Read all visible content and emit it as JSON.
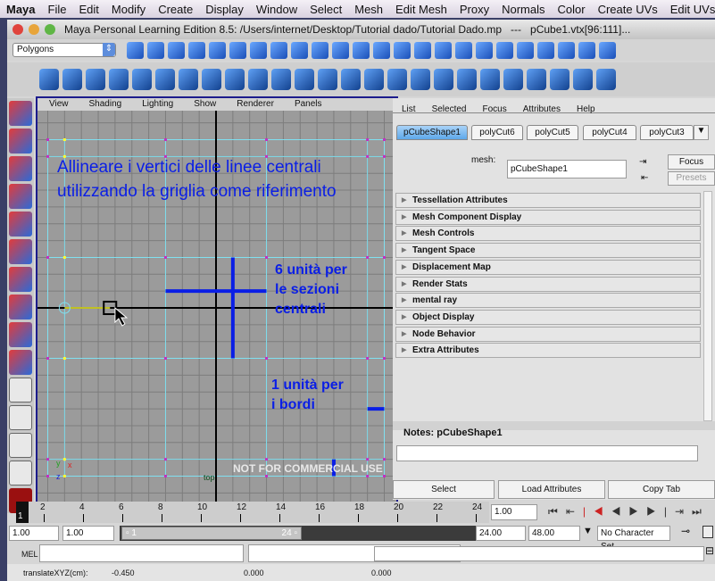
{
  "menubar": [
    "Maya",
    "File",
    "Edit",
    "Modify",
    "Create",
    "Display",
    "Window",
    "Select",
    "Mesh",
    "Edit Mesh",
    "Proxy",
    "Normals",
    "Color",
    "Create UVs",
    "Edit UVs"
  ],
  "window": {
    "title": "Maya Personal Learning Edition 8.5: /Users/internet/Desktop/Tutorial dado/Tutorial Dado.mp   ---   pCube1.vtx[96:111]..."
  },
  "mode_selector": "Polygons",
  "status_icons": [
    "new-scene-icon",
    "open-scene-icon",
    "save-scene-icon",
    "select-hierarchy-icon",
    "select-object-icon",
    "select-component-icon",
    "snap-grid-icon",
    "snap-curve-icon",
    "snap-point-icon",
    "snap-plane-icon",
    "snap-live-icon",
    "render-icon",
    "ipr-icon",
    "help-icon",
    "lock-icon",
    "selection-mask-icon",
    "construction-history-icon",
    "render-view-icon",
    "render-settings-icon",
    "hypershade-icon",
    "magnet-icon",
    "attribute-editor-icon",
    "tool-settings-icon",
    "channel-box-icon"
  ],
  "shelf_icons": [
    "poly-sphere-icon",
    "poly-cube-icon",
    "poly-cylinder-icon",
    "poly-cone-icon",
    "poly-plane-icon",
    "poly-torus-icon",
    "poly-prism-icon",
    "poly-pipe-icon",
    "poly-soccer-icon",
    "combine-icon",
    "separate-icon",
    "smooth-icon",
    "smooth-proxy-icon",
    "extrude-icon",
    "bridge-icon",
    "append-icon",
    "fill-hole-icon",
    "split-polygon-icon",
    "insert-edge-loop-icon",
    "offset-edge-icon",
    "slide-edge-icon",
    "cut-faces-icon",
    "merge-icon",
    "wedge-icon",
    "soft-mod-icon"
  ],
  "tools": [
    "select-tool-icon",
    "lasso-tool-icon",
    "paint-select-icon",
    "move-tool-icon",
    "rotate-tool-icon",
    "scale-tool-icon",
    "universal-manipulator-icon",
    "soft-mod-tool-icon",
    "show-manipulator-icon",
    "last-tool-icon"
  ],
  "layouts": [
    "single-pane-layout-icon",
    "four-pane-layout-icon",
    "outliner-layout-icon",
    "graph-editor-layout-icon"
  ],
  "viewport": {
    "menu": [
      "View",
      "Shading",
      "Lighting",
      "Show",
      "Renderer",
      "Panels"
    ],
    "annotation_top": [
      "Allineare i vertici delle linee centrali",
      "utilizzando la griglia come riferimento"
    ],
    "annotation_mid": [
      "6 unità per",
      "le sezioni",
      "centrali"
    ],
    "annotation_low": [
      "1 unità per",
      "i bordi"
    ],
    "watermark": "NOT FOR COMMERCIAL USE",
    "camera": "top",
    "axis_x": "x",
    "axis_y": "y",
    "axis_z": "z",
    "annotation_color": "#0a1ee6"
  },
  "attribute_editor": {
    "menu": [
      "List",
      "Selected",
      "Focus",
      "Attributes",
      "Help"
    ],
    "tabs": [
      "pCubeShape1",
      "polyCut6",
      "polyCut5",
      "polyCut4",
      "polyCut3"
    ],
    "mesh_label": "mesh:",
    "mesh_value": "pCubeShape1",
    "focus": "Focus",
    "presets": "Presets",
    "sections": [
      "Tessellation Attributes",
      "Mesh Component Display",
      "Mesh Controls",
      "Tangent Space",
      "Displacement Map",
      "Render Stats",
      "mental ray",
      "Object Display",
      "Node Behavior",
      "Extra Attributes"
    ],
    "notes_label": "Notes:  pCubeShape1",
    "buttons": [
      "Select",
      "Load Attributes",
      "Copy Tab"
    ]
  },
  "timeline": {
    "ticks": [
      "2",
      "4",
      "6",
      "8",
      "10",
      "12",
      "14",
      "16",
      "18",
      "20",
      "22",
      "24"
    ],
    "current_frame": "1",
    "current_value": "1.00",
    "start": "1.00",
    "range_start": "1.00",
    "slider_start": "1",
    "slider_end": "24",
    "range_end": "24.00",
    "end": "48.00",
    "character_set": "No Character Set"
  },
  "command_line": {
    "label": "MEL",
    "value": ""
  },
  "help_line": {
    "label": "translateXYZ(cm):",
    "x": "-0.450",
    "y": "0.000",
    "z": "0.000"
  }
}
